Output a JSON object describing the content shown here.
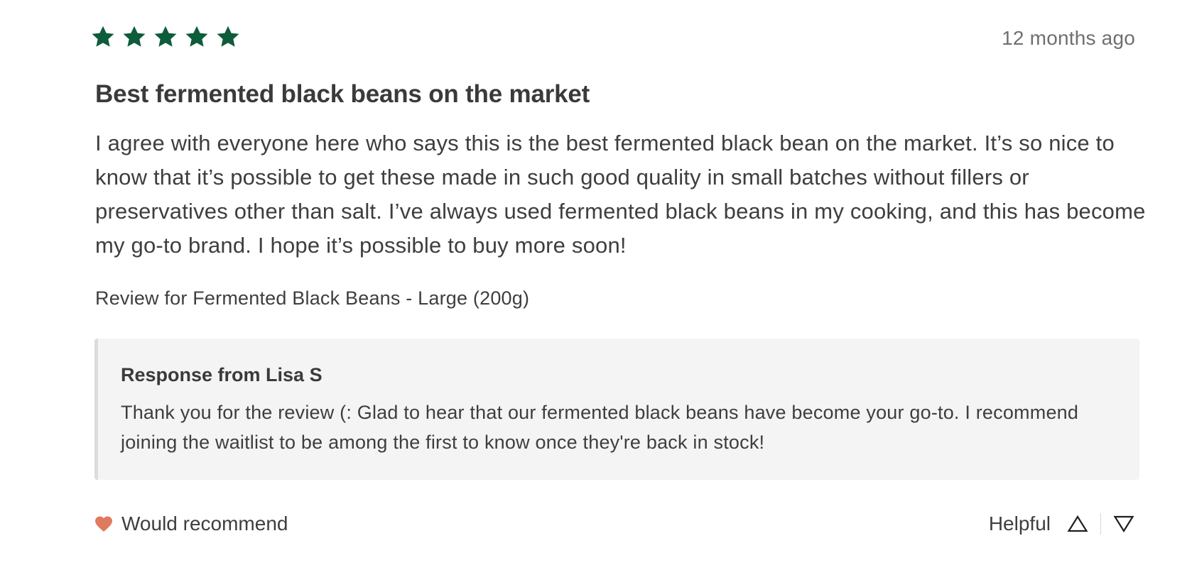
{
  "review": {
    "rating": 5,
    "max_rating": 5,
    "star_color": "#0d5c3a",
    "timestamp": "12 months ago",
    "title": "Best fermented black beans on the market",
    "body": "I agree with everyone here who says this is the best fermented black bean on the market. It’s so nice to know that it’s possible to get these made in such good quality in small batches without fillers or preservatives other than salt. I’ve always used fermented black beans in my cooking, and this has become my go-to brand. I hope it’s possible to buy more soon!",
    "product_line": "Review for Fermented Black Beans - Large (200g)"
  },
  "response": {
    "title": "Response from Lisa S",
    "text": "Thank you for the review (: Glad to hear that our fermented black beans have become your go-to. I recommend joining the waitlist to be among the first to know once they're back in stock!"
  },
  "footer": {
    "recommend_label": "Would recommend",
    "recommend_icon": "heart-icon",
    "heart_color": "#e07a5f",
    "helpful_label": "Helpful",
    "upvote_icon": "triangle-up-icon",
    "downvote_icon": "triangle-down-icon"
  }
}
